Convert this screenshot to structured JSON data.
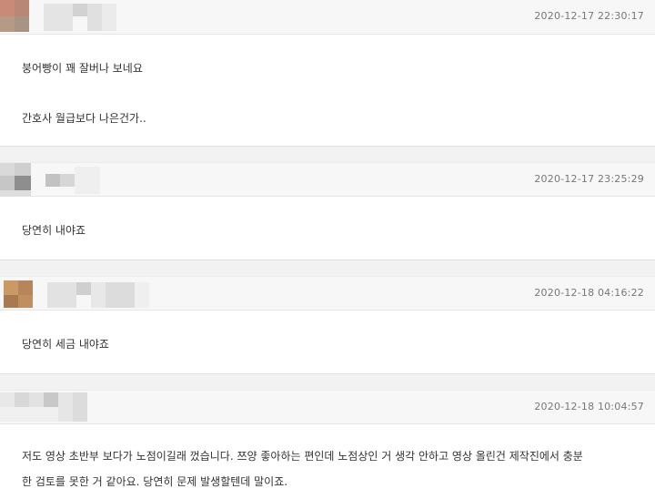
{
  "comments": [
    {
      "timestamp": "2020-12-17 22:30:17",
      "lines": [
        "붕어빵이 꽤 잘버나 보네요",
        "간호사 월급보다 나은건가.."
      ]
    },
    {
      "timestamp": "2020-12-17 23:25:29",
      "lines": [
        "당연히 내야죠"
      ]
    },
    {
      "timestamp": "2020-12-18 04:16:22",
      "lines": [
        "당연히 세금 내야죠"
      ]
    },
    {
      "timestamp": "2020-12-18 10:04:57",
      "lines": [
        "저도 영상 초반부 보다가 노점이길래 껐습니다. 쯔양 좋아하는 편인데 노점상인 거 생각 안하고 영상 올린건 제작진에서 충분",
        "한 검토를 못한 거 같아요. 당연히 문제 발생할텐데 말이죠."
      ]
    }
  ]
}
